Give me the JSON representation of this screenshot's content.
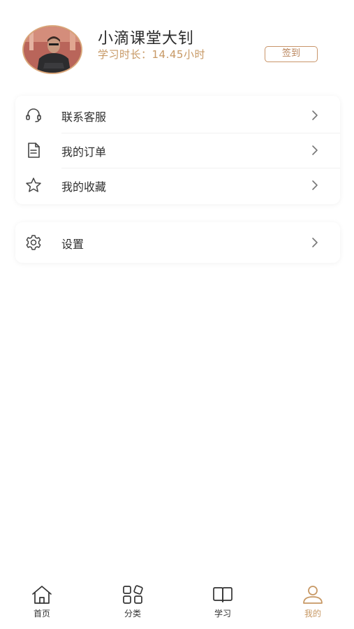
{
  "profile": {
    "username": "小滴课堂大钊",
    "study_time": "学习时长：14.45小时",
    "checkin_label": "签到"
  },
  "menu_group_1": [
    {
      "label": "联系客服",
      "icon": "headset-icon"
    },
    {
      "label": "我的订单",
      "icon": "document-icon"
    },
    {
      "label": "我的收藏",
      "icon": "star-icon"
    }
  ],
  "menu_group_2": [
    {
      "label": "设置",
      "icon": "gear-icon"
    }
  ],
  "tabbar": {
    "tabs": [
      {
        "label": "首页",
        "icon": "home-icon"
      },
      {
        "label": "分类",
        "icon": "category-icon"
      },
      {
        "label": "学习",
        "icon": "book-icon"
      },
      {
        "label": "我的",
        "icon": "user-icon",
        "active": true
      }
    ]
  },
  "colors": {
    "accent": "#c79864",
    "text": "#2f2f2f",
    "icon": "#444444"
  }
}
